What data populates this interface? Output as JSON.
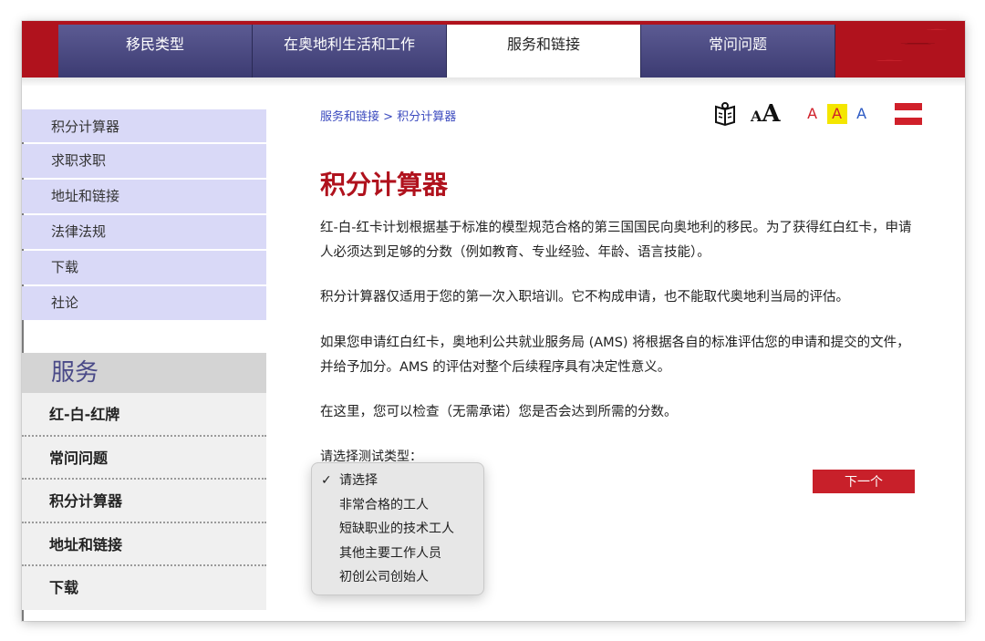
{
  "nav": {
    "tabs": [
      {
        "label": "移民类型"
      },
      {
        "label": "在奥地利生活和工作"
      },
      {
        "label": "服务和链接"
      },
      {
        "label": "常问问题"
      }
    ]
  },
  "sidebar": {
    "items": [
      {
        "label": "积分计算器"
      },
      {
        "label": "求职求职"
      },
      {
        "label": "地址和链接"
      },
      {
        "label": "法律法规"
      },
      {
        "label": "下载"
      },
      {
        "label": "社论"
      }
    ],
    "services_title": "服务",
    "services": [
      {
        "label": "红-白-红牌"
      },
      {
        "label": "常问问题"
      },
      {
        "label": "积分计算器"
      },
      {
        "label": "地址和链接"
      },
      {
        "label": "下载"
      }
    ]
  },
  "breadcrumb": {
    "parent": "服务和链接",
    "separator": ">",
    "current": "积分计算器"
  },
  "tools": {
    "text_size_small": "A",
    "text_size_large": "A",
    "contrast_1": "A",
    "contrast_2": "A",
    "contrast_3": "A",
    "book_icon": "book-reader-icon",
    "flag_icon": "austria-flag-icon",
    "colors": {
      "flag_red": "#d0202a",
      "flag_white": "#ffffff"
    }
  },
  "main": {
    "title": "积分计算器",
    "paragraphs": [
      "红-白-红卡计划根据基于标准的模型规范合格的第三国国民向奥地利的移民。为了获得红白红卡，申请人必须达到足够的分数（例如教育、专业经验、年龄、语言技能）。",
      "积分计算器仅适用于您的第一次入职培训。它不构成申请，也不能取代奥地利当局的评估。",
      "如果您申请红白红卡，奥地利公共就业服务局 (AMS) 将根据各自的标准评估您的申请和提交的文件，并给予加分。AMS 的评估对整个后续程序具有决定性意义。",
      "在这里，您可以检查（无需承诺）您是否会达到所需的分数。"
    ],
    "select_label": "请选择测试类型：",
    "select_options": [
      {
        "label": "请选择",
        "selected": true
      },
      {
        "label": "非常合格的工人"
      },
      {
        "label": "短缺职业的技术工人"
      },
      {
        "label": "其他主要工作人员"
      },
      {
        "label": "初创公司创始人"
      }
    ],
    "check_mark": "✓",
    "next_button": "下一个"
  },
  "colors": {
    "brand_red": "#b0121d",
    "nav_purple": "#4a4982",
    "sidebar_lavender": "#d9d9f7",
    "link_blue": "#3c4bbf"
  }
}
